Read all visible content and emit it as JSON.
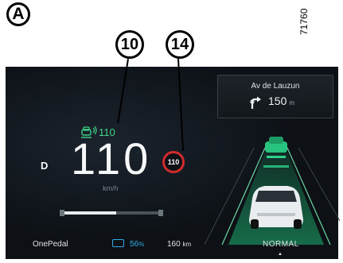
{
  "annotation": {
    "figure_label": "A",
    "callout_1": "10",
    "callout_2": "14",
    "reference_code": "71760"
  },
  "navigation": {
    "street": "Av de Lauzun",
    "distance": "150",
    "distance_unit": "m",
    "turn_icon": "turn-right-arrow-icon"
  },
  "cruise": {
    "set_speed": "110",
    "icon": "adaptive-cruise-icon",
    "color": "#3ed48a"
  },
  "speedometer": {
    "gear": "D",
    "speed": "110",
    "unit": "km/h"
  },
  "speed_limit": {
    "value": "110",
    "ring_color": "#d22b2b"
  },
  "regen_gauge": {
    "level_fraction": 0.55
  },
  "status": {
    "mode": "OnePedal",
    "battery_percent": "56",
    "battery_percent_unit": "%",
    "range": "160",
    "range_unit": "km",
    "drive_mode": "NORMAL",
    "drive_mode_caret": "▲",
    "battery_color": "#33a8e6"
  }
}
